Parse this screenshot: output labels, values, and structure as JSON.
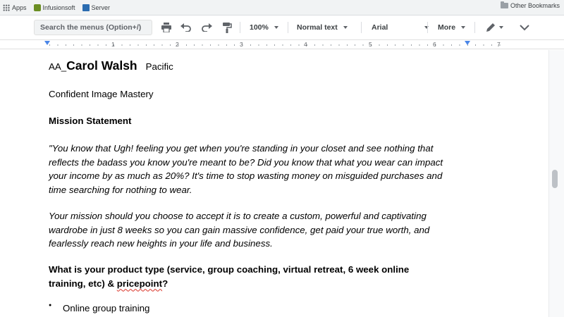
{
  "bookmarks": {
    "apps": "Apps",
    "items": [
      "Infusionsoft",
      "Server"
    ],
    "other": "Other Bookmarks"
  },
  "toolbar": {
    "search_placeholder": "Search the menus (Option+/)",
    "zoom": "100%",
    "style": "Normal text",
    "font": "Arial",
    "more": "More"
  },
  "ruler": {
    "numbers": [
      "1",
      "2",
      "3",
      "4",
      "5",
      "6",
      "7"
    ]
  },
  "document": {
    "title_prefix": "AA_",
    "title_name": "Carol Walsh",
    "title_region": "Pacific",
    "subtitle": "Confident Image Mastery",
    "mission_heading": "Mission Statement",
    "mission_lines": [
      "\"You know that Ugh! feeling you get when you're standing in your closet and see nothing that",
      "reflects the badass you know you're meant to be? Did you know that what you wear can impact",
      "your income by as much as 20%? It's time to stop wasting money on misguided purchases and",
      "time searching for nothing to wear."
    ],
    "mission_lines_2": [
      "Your mission should you choose to accept it is to create a custom, powerful and captivating",
      "wardrobe in just 8 weeks so you can gain massive confidence, get paid your true worth, and",
      "fearlessly reach new heights in your life and business."
    ],
    "product_question_line1": "What is your product type (service, group coaching, virtual retreat, 6 week online",
    "product_question_line2_a": "training, etc) & ",
    "product_question_line2_b": "pricepoint",
    "product_question_line2_c": "?",
    "bullet_item": "Online group training"
  }
}
